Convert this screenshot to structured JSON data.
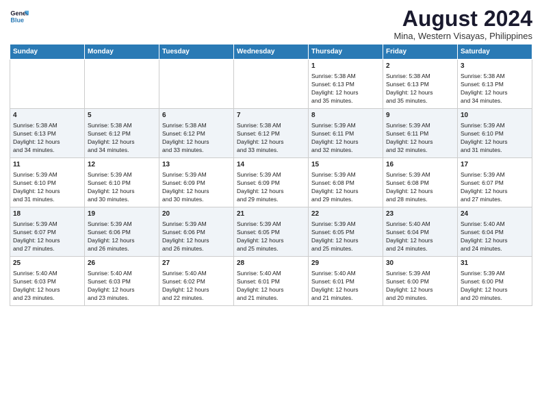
{
  "logo": {
    "line1": "General",
    "line2": "Blue"
  },
  "title": "August 2024",
  "subtitle": "Mina, Western Visayas, Philippines",
  "days_of_week": [
    "Sunday",
    "Monday",
    "Tuesday",
    "Wednesday",
    "Thursday",
    "Friday",
    "Saturday"
  ],
  "weeks": [
    [
      {
        "day": "",
        "content": ""
      },
      {
        "day": "",
        "content": ""
      },
      {
        "day": "",
        "content": ""
      },
      {
        "day": "",
        "content": ""
      },
      {
        "day": "1",
        "content": "Sunrise: 5:38 AM\nSunset: 6:13 PM\nDaylight: 12 hours\nand 35 minutes."
      },
      {
        "day": "2",
        "content": "Sunrise: 5:38 AM\nSunset: 6:13 PM\nDaylight: 12 hours\nand 35 minutes."
      },
      {
        "day": "3",
        "content": "Sunrise: 5:38 AM\nSunset: 6:13 PM\nDaylight: 12 hours\nand 34 minutes."
      }
    ],
    [
      {
        "day": "4",
        "content": "Sunrise: 5:38 AM\nSunset: 6:13 PM\nDaylight: 12 hours\nand 34 minutes."
      },
      {
        "day": "5",
        "content": "Sunrise: 5:38 AM\nSunset: 6:12 PM\nDaylight: 12 hours\nand 34 minutes."
      },
      {
        "day": "6",
        "content": "Sunrise: 5:38 AM\nSunset: 6:12 PM\nDaylight: 12 hours\nand 33 minutes."
      },
      {
        "day": "7",
        "content": "Sunrise: 5:38 AM\nSunset: 6:12 PM\nDaylight: 12 hours\nand 33 minutes."
      },
      {
        "day": "8",
        "content": "Sunrise: 5:39 AM\nSunset: 6:11 PM\nDaylight: 12 hours\nand 32 minutes."
      },
      {
        "day": "9",
        "content": "Sunrise: 5:39 AM\nSunset: 6:11 PM\nDaylight: 12 hours\nand 32 minutes."
      },
      {
        "day": "10",
        "content": "Sunrise: 5:39 AM\nSunset: 6:10 PM\nDaylight: 12 hours\nand 31 minutes."
      }
    ],
    [
      {
        "day": "11",
        "content": "Sunrise: 5:39 AM\nSunset: 6:10 PM\nDaylight: 12 hours\nand 31 minutes."
      },
      {
        "day": "12",
        "content": "Sunrise: 5:39 AM\nSunset: 6:10 PM\nDaylight: 12 hours\nand 30 minutes."
      },
      {
        "day": "13",
        "content": "Sunrise: 5:39 AM\nSunset: 6:09 PM\nDaylight: 12 hours\nand 30 minutes."
      },
      {
        "day": "14",
        "content": "Sunrise: 5:39 AM\nSunset: 6:09 PM\nDaylight: 12 hours\nand 29 minutes."
      },
      {
        "day": "15",
        "content": "Sunrise: 5:39 AM\nSunset: 6:08 PM\nDaylight: 12 hours\nand 29 minutes."
      },
      {
        "day": "16",
        "content": "Sunrise: 5:39 AM\nSunset: 6:08 PM\nDaylight: 12 hours\nand 28 minutes."
      },
      {
        "day": "17",
        "content": "Sunrise: 5:39 AM\nSunset: 6:07 PM\nDaylight: 12 hours\nand 27 minutes."
      }
    ],
    [
      {
        "day": "18",
        "content": "Sunrise: 5:39 AM\nSunset: 6:07 PM\nDaylight: 12 hours\nand 27 minutes."
      },
      {
        "day": "19",
        "content": "Sunrise: 5:39 AM\nSunset: 6:06 PM\nDaylight: 12 hours\nand 26 minutes."
      },
      {
        "day": "20",
        "content": "Sunrise: 5:39 AM\nSunset: 6:06 PM\nDaylight: 12 hours\nand 26 minutes."
      },
      {
        "day": "21",
        "content": "Sunrise: 5:39 AM\nSunset: 6:05 PM\nDaylight: 12 hours\nand 25 minutes."
      },
      {
        "day": "22",
        "content": "Sunrise: 5:39 AM\nSunset: 6:05 PM\nDaylight: 12 hours\nand 25 minutes."
      },
      {
        "day": "23",
        "content": "Sunrise: 5:40 AM\nSunset: 6:04 PM\nDaylight: 12 hours\nand 24 minutes."
      },
      {
        "day": "24",
        "content": "Sunrise: 5:40 AM\nSunset: 6:04 PM\nDaylight: 12 hours\nand 24 minutes."
      }
    ],
    [
      {
        "day": "25",
        "content": "Sunrise: 5:40 AM\nSunset: 6:03 PM\nDaylight: 12 hours\nand 23 minutes."
      },
      {
        "day": "26",
        "content": "Sunrise: 5:40 AM\nSunset: 6:03 PM\nDaylight: 12 hours\nand 23 minutes."
      },
      {
        "day": "27",
        "content": "Sunrise: 5:40 AM\nSunset: 6:02 PM\nDaylight: 12 hours\nand 22 minutes."
      },
      {
        "day": "28",
        "content": "Sunrise: 5:40 AM\nSunset: 6:01 PM\nDaylight: 12 hours\nand 21 minutes."
      },
      {
        "day": "29",
        "content": "Sunrise: 5:40 AM\nSunset: 6:01 PM\nDaylight: 12 hours\nand 21 minutes."
      },
      {
        "day": "30",
        "content": "Sunrise: 5:39 AM\nSunset: 6:00 PM\nDaylight: 12 hours\nand 20 minutes."
      },
      {
        "day": "31",
        "content": "Sunrise: 5:39 AM\nSunset: 6:00 PM\nDaylight: 12 hours\nand 20 minutes."
      }
    ]
  ]
}
